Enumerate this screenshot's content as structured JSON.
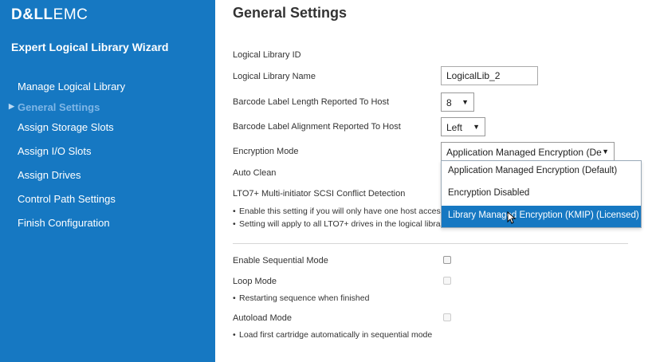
{
  "brand": {
    "dell": "D&LL",
    "emc": "EMC"
  },
  "wizard_title": "Expert Logical Library Wizard",
  "nav": [
    {
      "label": "Manage Logical Library",
      "active": false
    },
    {
      "label": "General Settings",
      "active": true
    },
    {
      "label": "Assign Storage Slots",
      "active": false
    },
    {
      "label": "Assign I/O Slots",
      "active": false
    },
    {
      "label": "Assign Drives",
      "active": false
    },
    {
      "label": "Control Path Settings",
      "active": false
    },
    {
      "label": "Finish Configuration",
      "active": false
    }
  ],
  "page_title": "General Settings",
  "fields": {
    "library_id": {
      "label": "Logical Library ID"
    },
    "library_name": {
      "label": "Logical Library Name",
      "value": "LogicalLib_2"
    },
    "barcode_length": {
      "label": "Barcode Label Length Reported To Host",
      "value": "8"
    },
    "barcode_alignment": {
      "label": "Barcode Label Alignment Reported To Host",
      "value": "Left"
    },
    "encryption": {
      "label": "Encryption Mode",
      "value": "Application Managed Encryption (De",
      "options": [
        "Application Managed Encryption (Default)",
        "Encryption Disabled",
        "Library Managed Encryption (KMIP) (Licensed)"
      ],
      "highlighted_index": 2
    },
    "auto_clean": {
      "label": "Auto Clean"
    },
    "lto7": {
      "label": "LTO7+ Multi-initiator SCSI Conflict Detection",
      "notes": [
        "Enable this setting if you will only have one host access",
        "Setting will apply to all LTO7+ drives in the logical libra"
      ]
    },
    "sequential_mode": {
      "label": "Enable Sequential Mode",
      "checked": false
    },
    "loop_mode": {
      "label": "Loop Mode",
      "note": "Restarting sequence when finished",
      "checked": false,
      "disabled": true
    },
    "autoload_mode": {
      "label": "Autoload Mode",
      "note": "Load first cartridge automatically in sequential mode",
      "checked": false,
      "disabled": true
    }
  },
  "colors": {
    "sidebar": "#1678c2",
    "active_nav": "#7fb6e6",
    "selected_option": "#1678c2"
  },
  "icons": {
    "active_marker": "triangle-right-icon",
    "select_caret": "caret-down-icon",
    "cursor": "mouse-pointer-icon"
  }
}
